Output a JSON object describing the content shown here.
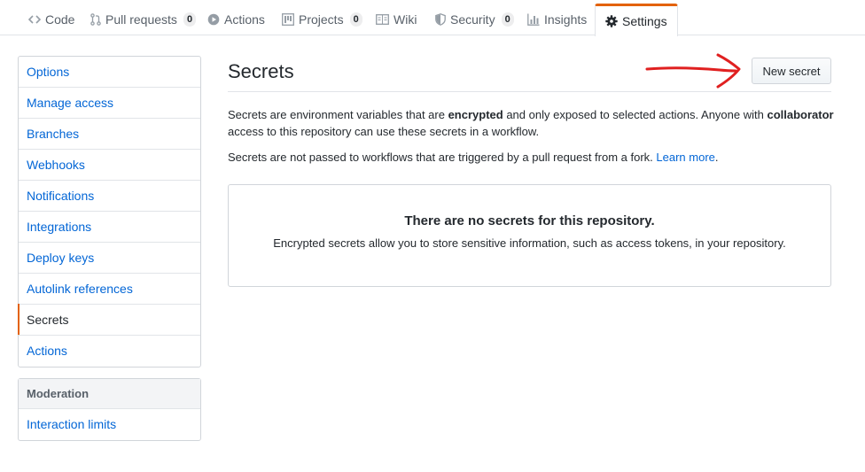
{
  "tabs": [
    {
      "label": "Code",
      "icon": "code-icon",
      "counter": null
    },
    {
      "label": "Pull requests",
      "icon": "pull-request-icon",
      "counter": "0"
    },
    {
      "label": "Actions",
      "icon": "play-icon",
      "counter": null
    },
    {
      "label": "Projects",
      "icon": "project-icon",
      "counter": "0"
    },
    {
      "label": "Wiki",
      "icon": "book-icon",
      "counter": null
    },
    {
      "label": "Security",
      "icon": "shield-icon",
      "counter": "0"
    },
    {
      "label": "Insights",
      "icon": "graph-icon",
      "counter": null
    },
    {
      "label": "Settings",
      "icon": "gear-icon",
      "counter": null,
      "selected": true
    }
  ],
  "sidebar": {
    "items": [
      {
        "label": "Options"
      },
      {
        "label": "Manage access"
      },
      {
        "label": "Branches"
      },
      {
        "label": "Webhooks"
      },
      {
        "label": "Notifications"
      },
      {
        "label": "Integrations"
      },
      {
        "label": "Deploy keys"
      },
      {
        "label": "Autolink references"
      },
      {
        "label": "Secrets",
        "selected": true
      },
      {
        "label": "Actions"
      }
    ],
    "moderation": {
      "heading": "Moderation",
      "items": [
        {
          "label": "Interaction limits"
        }
      ]
    }
  },
  "main": {
    "title": "Secrets",
    "new_button": "New secret",
    "desc1": {
      "part1": "Secrets are environment variables that are ",
      "bold1": "encrypted",
      "part2": " and only exposed to selected actions. Anyone with ",
      "bold2": "collaborator",
      "part3": " access to this repository can use these secrets in a workflow."
    },
    "desc2": {
      "text": "Secrets are not passed to workflows that are triggered by a pull request from a fork. ",
      "link": "Learn more",
      "end": "."
    },
    "blankslate": {
      "title": "There are no secrets for this repository.",
      "text": "Encrypted secrets allow you to store sensitive information, such as access tokens, in your repository."
    }
  },
  "colors": {
    "accent": "#e36209",
    "link": "#0366d6",
    "annotation_arrow": "#e02020"
  }
}
